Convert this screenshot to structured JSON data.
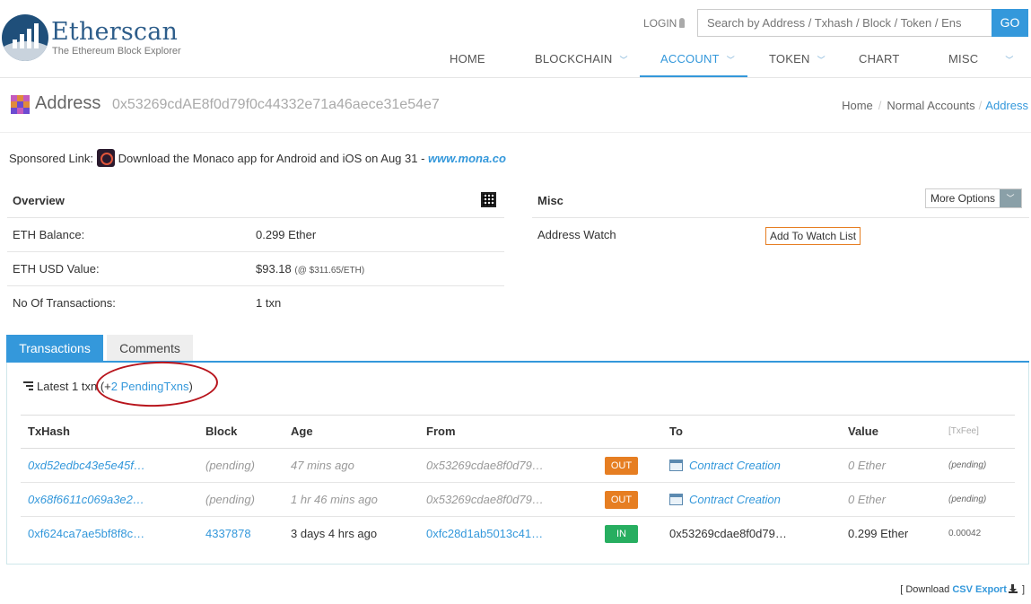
{
  "brand": {
    "title": "Etherscan",
    "subtitle": "The Ethereum Block Explorer"
  },
  "header": {
    "login_label": "LOGIN",
    "search_placeholder": "Search by Address / Txhash / Block / Token / Ens",
    "search_button": "GO"
  },
  "nav": {
    "items": [
      {
        "label": "HOME"
      },
      {
        "label": "BLOCKCHAIN"
      },
      {
        "label": "ACCOUNT"
      },
      {
        "label": "TOKEN"
      },
      {
        "label": "CHART"
      },
      {
        "label": "MISC"
      }
    ],
    "active": "ACCOUNT"
  },
  "page": {
    "title": "Address",
    "address": "0x53269cdAE8f0d79f0c44332e71a46aece31e54e7",
    "breadcrumb": [
      "Home",
      "Normal Accounts",
      "Address"
    ]
  },
  "sponsored": {
    "label": "Sponsored Link:",
    "text": "Download the Monaco app for Android and iOS on Aug 31 -",
    "link": "www.mona.co"
  },
  "overview": {
    "heading": "Overview",
    "rows": [
      {
        "label": "ETH Balance:",
        "value": "0.299 Ether",
        "extra": ""
      },
      {
        "label": "ETH USD Value:",
        "value": "$93.18",
        "extra": "(@ $311.65/ETH)"
      },
      {
        "label": "No Of Transactions:",
        "value": "1 txn",
        "extra": ""
      }
    ]
  },
  "misc": {
    "heading": "Misc",
    "more_options": "More Options",
    "watch_label": "Address Watch",
    "watch_button": "Add To Watch List"
  },
  "tabs": [
    "Transactions",
    "Comments"
  ],
  "txns": {
    "latest_prefix": "Latest 1 txn",
    "pending_open": "(+",
    "pending_link": "2 PendingTxns",
    "pending_close": ")",
    "columns": [
      "TxHash",
      "Block",
      "Age",
      "From",
      "",
      "To",
      "Value",
      "[TxFee]"
    ],
    "rows": [
      {
        "hash": "0xd52edbc43e5e45f…",
        "block": "(pending)",
        "age": "47 mins ago",
        "from": "0x53269cdae8f0d79…",
        "dir": "OUT",
        "to": "Contract Creation",
        "value": "0 Ether",
        "fee": "(pending)"
      },
      {
        "hash": "0x68f6611c069a3e2…",
        "block": "(pending)",
        "age": "1 hr 46 mins ago",
        "from": "0x53269cdae8f0d79…",
        "dir": "OUT",
        "to": "Contract Creation",
        "value": "0 Ether",
        "fee": "(pending)"
      },
      {
        "hash": "0xf624ca7ae5bf8f8c…",
        "block": "4337878",
        "age": "3 days 4 hrs ago",
        "from": "0xfc28d1ab5013c41…",
        "dir": "IN",
        "to": "0x53269cdae8f0d79…",
        "value": "0.299 Ether",
        "fee": "0.00042"
      }
    ]
  },
  "footer": {
    "download_open": "[ Download",
    "csv_link": "CSV Export",
    "download_close": "]"
  },
  "colors": {
    "accent": "#3498db",
    "out": "#e67e22",
    "in": "#27ae60",
    "annotation": "#b8141c"
  }
}
